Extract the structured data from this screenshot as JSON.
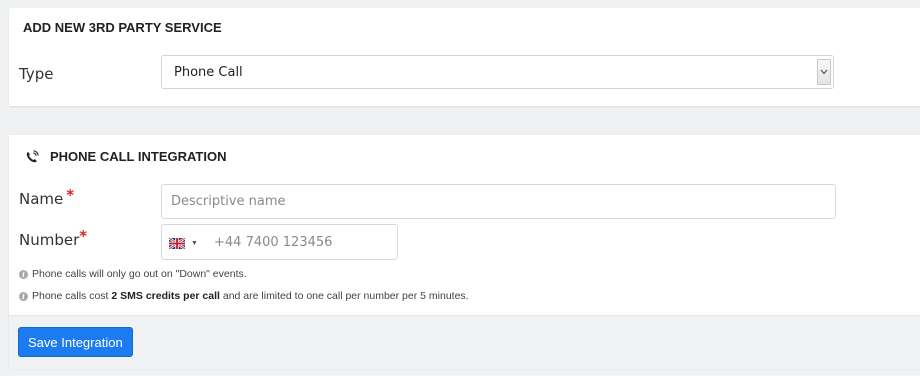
{
  "add_service": {
    "title": "ADD NEW 3RD PARTY SERVICE",
    "type_label": "Type",
    "type_value": "Phone Call"
  },
  "integration": {
    "title": "PHONE CALL INTEGRATION",
    "icon": "phone-ringing-icon",
    "name_label": "Name",
    "name_placeholder": "Descriptive name",
    "required_mark": "*",
    "number_label": "Number",
    "number_placeholder": "+44 7400 123456",
    "country_flag": "uk-flag-icon",
    "note1": "Phone calls will only go out on \"Down\" events.",
    "note2_prefix": "Phone calls cost ",
    "note2_bold": "2 SMS credits per call",
    "note2_suffix": " and are limited to one call per number per 5 minutes.",
    "save_label": "Save Integration"
  },
  "colors": {
    "primary": "#1b7bef",
    "required": "#e02020",
    "background": "#f0f1f3"
  }
}
